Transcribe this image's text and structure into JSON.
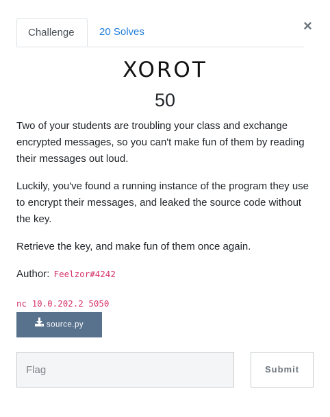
{
  "tabs": {
    "challenge_label": "Challenge",
    "solves_label": "20 Solves"
  },
  "close_glyph": "×",
  "challenge": {
    "name": "XOROT",
    "points": "50",
    "description": [
      "Two of your students are troubling your class and exchange encrypted messages, so you can't make fun of them by reading their messages out loud.",
      "Luckily, you've found a running instance of the program they use to encrypt their messages, and leaked the source code without the key.",
      "Retrieve the key, and make fun of them once again."
    ],
    "author_label": "Author:",
    "author": "Feelzor#4242",
    "connection": "nc 10.0.202.2 5050",
    "file": {
      "icon": "download-icon",
      "name": "source.py"
    }
  },
  "form": {
    "flag_placeholder": "Flag",
    "submit_label": "Submit"
  },
  "colors": {
    "tab_link": "#1e7bd8",
    "code": "#d6336c",
    "file_button": "#58728e"
  }
}
